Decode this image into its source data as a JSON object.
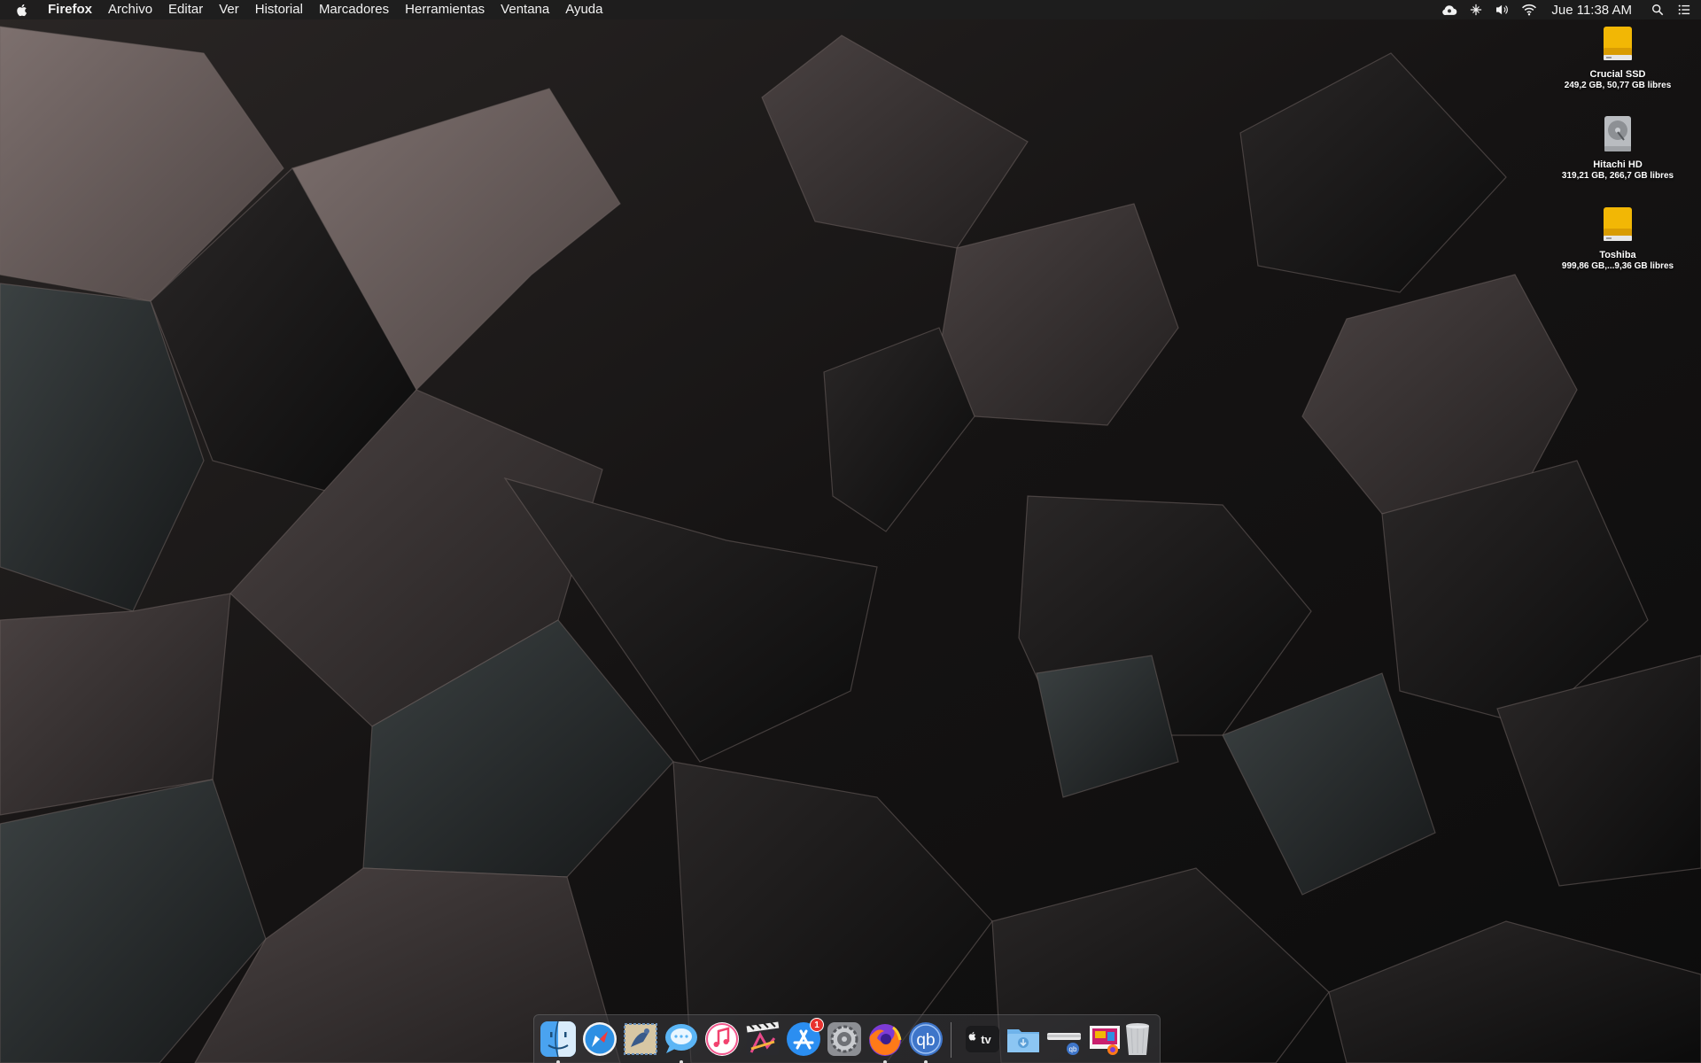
{
  "menubar": {
    "app_name": "Firefox",
    "menus": [
      "Archivo",
      "Editar",
      "Ver",
      "Historial",
      "Marcadores",
      "Herramientas",
      "Ventana",
      "Ayuda"
    ],
    "clock": "Jue 11:38 AM",
    "status_icons": [
      "creative-cloud-icon",
      "input-menu-icon",
      "volume-icon",
      "wifi-icon",
      "spotlight-search-icon",
      "notification-center-icon"
    ]
  },
  "drives": [
    {
      "name": "Crucial SSD",
      "info": "249,2 GB, 50,77 GB libres",
      "icon": "external-drive-icon",
      "color": "#f2b705"
    },
    {
      "name": "Hitachi HD",
      "info": "319,21 GB, 266,7 GB libres",
      "icon": "internal-hard-drive-icon",
      "color": "#b9bcc0"
    },
    {
      "name": "Toshiba",
      "info": "999,86 GB,...9,36 GB libres",
      "icon": "external-drive-icon",
      "color": "#f2b705"
    }
  ],
  "dock": {
    "apps": [
      {
        "name": "Finder",
        "icon": "finder-icon",
        "running": true
      },
      {
        "name": "Safari",
        "icon": "safari-icon",
        "running": false
      },
      {
        "name": "Mail",
        "icon": "mail-icon",
        "running": false
      },
      {
        "name": "Messages",
        "icon": "messages-icon",
        "running": true
      },
      {
        "name": "iTunes",
        "icon": "itunes-icon",
        "running": false
      },
      {
        "name": "Final Cut Pro",
        "icon": "final-cut-pro-icon",
        "running": false
      },
      {
        "name": "App Store",
        "icon": "app-store-icon",
        "running": false,
        "badge": "1"
      },
      {
        "name": "System Preferences",
        "icon": "system-preferences-icon",
        "running": false
      },
      {
        "name": "Firefox",
        "icon": "firefox-icon",
        "running": true
      },
      {
        "name": "qBittorrent",
        "icon": "qbittorrent-icon",
        "running": true
      }
    ],
    "others": [
      {
        "name": "TV",
        "icon": "apple-tv-icon",
        "label": "tv"
      },
      {
        "name": "Downloads",
        "icon": "downloads-folder-icon"
      },
      {
        "name": "Stack",
        "icon": "download-stack-icon"
      },
      {
        "name": "Recent",
        "icon": "recent-stack-icon"
      },
      {
        "name": "Trash",
        "icon": "trash-icon"
      }
    ]
  }
}
